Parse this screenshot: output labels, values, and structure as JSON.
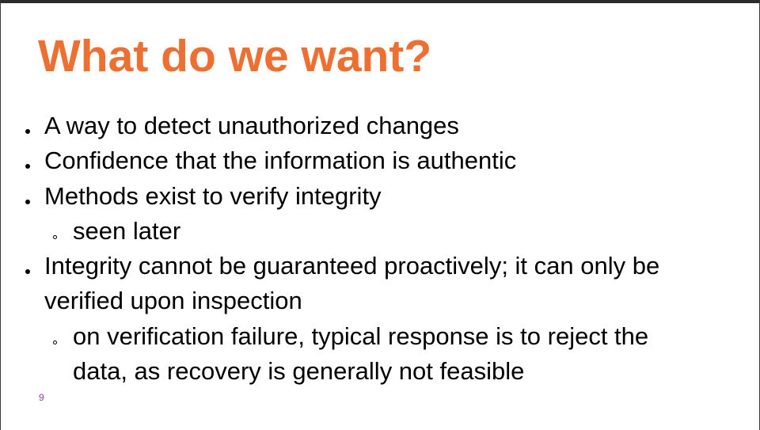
{
  "slide": {
    "title": "What do we want?",
    "bullets": [
      {
        "level": 1,
        "text": "A way to detect unauthorized changes"
      },
      {
        "level": 1,
        "text": "Confidence that the information is authentic"
      },
      {
        "level": 1,
        "text": "Methods exist to verify integrity"
      },
      {
        "level": 2,
        "text": "seen later"
      },
      {
        "level": 1,
        "text": "Integrity cannot be guaranteed proactively; it can only be verified upon inspection"
      },
      {
        "level": 2,
        "text": "on verification failure, typical response is to reject the data, as recovery is generally not feasible"
      }
    ],
    "slide_number": "9"
  },
  "colors": {
    "title": "#ed7032",
    "body_text": "#000000",
    "slide_number": "#8b3ea8",
    "background": "#ffffff"
  }
}
